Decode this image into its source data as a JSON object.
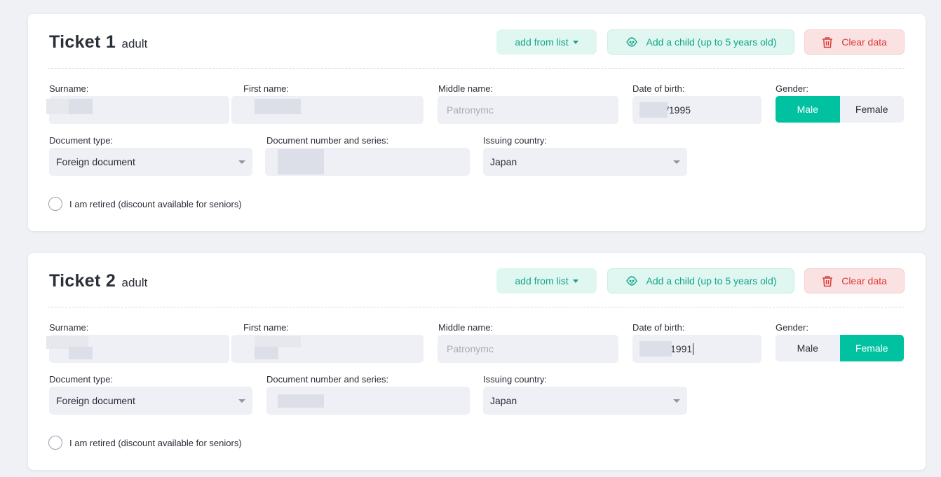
{
  "tickets": [
    {
      "title": "Ticket 1",
      "subtitle": "adult",
      "add_from_list_label": "add from list",
      "add_child_label": "Add a child (up to 5 years old)",
      "clear_label": "Clear data",
      "surname_label": "Surname:",
      "surname_value": "",
      "first_name_label": "First name:",
      "first_name_value": "",
      "middle_name_label": "Middle name:",
      "middle_name_placeholder": "Patronymc",
      "dob_label": "Date of birth:",
      "dob_value": "/1995",
      "gender_label": "Gender:",
      "gender_options": [
        "Male",
        "Female"
      ],
      "gender_selected": "Male",
      "doc_type_label": "Document type:",
      "doc_type_value": "Foreign document",
      "doc_number_label": "Document number and series:",
      "doc_number_value": "",
      "country_label": "Issuing country:",
      "country_value": "Japan",
      "retired_label": "I am retired (discount available for seniors)",
      "retired_checked": false
    },
    {
      "title": "Ticket 2",
      "subtitle": "adult",
      "add_from_list_label": "add from list",
      "add_child_label": "Add a child (up to 5 years old)",
      "clear_label": "Clear data",
      "surname_label": "Surname:",
      "surname_value": "",
      "first_name_label": "First name:",
      "first_name_value": "",
      "middle_name_label": "Middle name:",
      "middle_name_placeholder": "Patronymc",
      "dob_label": "Date of birth:",
      "dob_value": "1991",
      "gender_label": "Gender:",
      "gender_options": [
        "Male",
        "Female"
      ],
      "gender_selected": "Female",
      "doc_type_label": "Document type:",
      "doc_type_value": "Foreign document",
      "doc_number_label": "Document number and series:",
      "doc_number_value": "",
      "country_label": "Issuing country:",
      "country_value": "Japan",
      "retired_label": "I am retired (discount available for seniors)",
      "retired_checked": false
    }
  ],
  "icons": {
    "dropdown": "chevron-down-icon",
    "child": "child-face-icon",
    "clear": "trash-icon"
  },
  "colors": {
    "accent": "#00c2a0",
    "accent_text": "#14a58a",
    "accent_bg": "#dff6f1",
    "danger_text": "#dc3a3a",
    "danger_bg": "#fbe2e2",
    "field_bg": "#eef0f5",
    "page_bg": "#f0f1f5"
  }
}
